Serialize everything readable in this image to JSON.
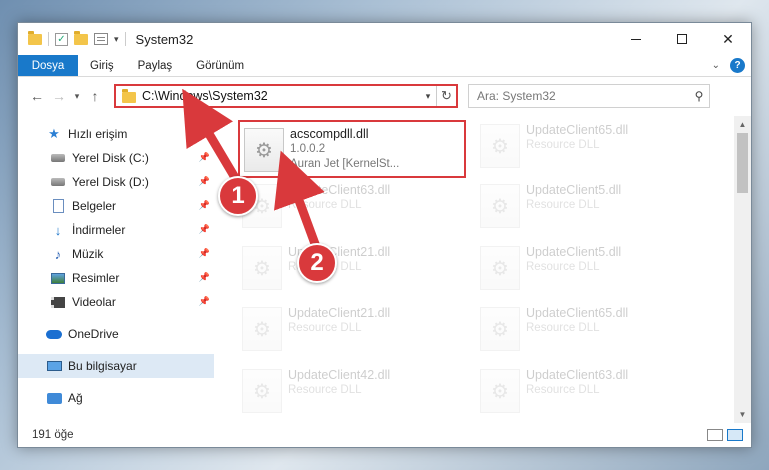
{
  "window": {
    "title": "System32"
  },
  "ribbon": {
    "tabs": [
      "Dosya",
      "Giriş",
      "Paylaş",
      "Görünüm"
    ]
  },
  "address": {
    "path": "C:\\Windows\\System32",
    "search_placeholder": "Ara: System32"
  },
  "sidebar": {
    "quick_access": "Hızlı erişim",
    "items": [
      {
        "label": "Yerel Disk (C:)",
        "icon": "disk-icon"
      },
      {
        "label": "Yerel Disk (D:)",
        "icon": "disk-icon"
      },
      {
        "label": "Belgeler",
        "icon": "documents-icon"
      },
      {
        "label": "İndirmeler",
        "icon": "downloads-icon"
      },
      {
        "label": "Müzik",
        "icon": "music-icon"
      },
      {
        "label": "Resimler",
        "icon": "pictures-icon"
      },
      {
        "label": "Videolar",
        "icon": "videos-icon"
      }
    ],
    "onedrive": "OneDrive",
    "this_pc": "Bu bilgisayar",
    "network": "Ağ"
  },
  "files": {
    "highlighted": {
      "name": "acscompdll.dll",
      "version": "1.0.0.2",
      "company": "Auran Jet [KernelSt..."
    },
    "left_column": [
      {
        "name": "UpdateClient63.dll",
        "desc": "Resource DLL"
      },
      {
        "name": "UpdateClient21.dll",
        "desc": "Resource DLL"
      },
      {
        "name": "UpdateClient21.dll",
        "desc": "Resource DLL"
      },
      {
        "name": "UpdateClient42.dll",
        "desc": "Resource DLL"
      }
    ],
    "right_column": [
      {
        "name": "UpdateClient65.dll",
        "desc": "Resource DLL"
      },
      {
        "name": "UpdateClient5.dll",
        "desc": "Resource DLL"
      },
      {
        "name": "UpdateClient5.dll",
        "desc": "Resource DLL"
      },
      {
        "name": "UpdateClient65.dll",
        "desc": "Resource DLL"
      },
      {
        "name": "UpdateClient63.dll",
        "desc": "Resource DLL"
      }
    ]
  },
  "status": {
    "count": "191 öğe"
  },
  "annotations": {
    "marker1": "1",
    "marker2": "2",
    "color": "#d9393c"
  }
}
